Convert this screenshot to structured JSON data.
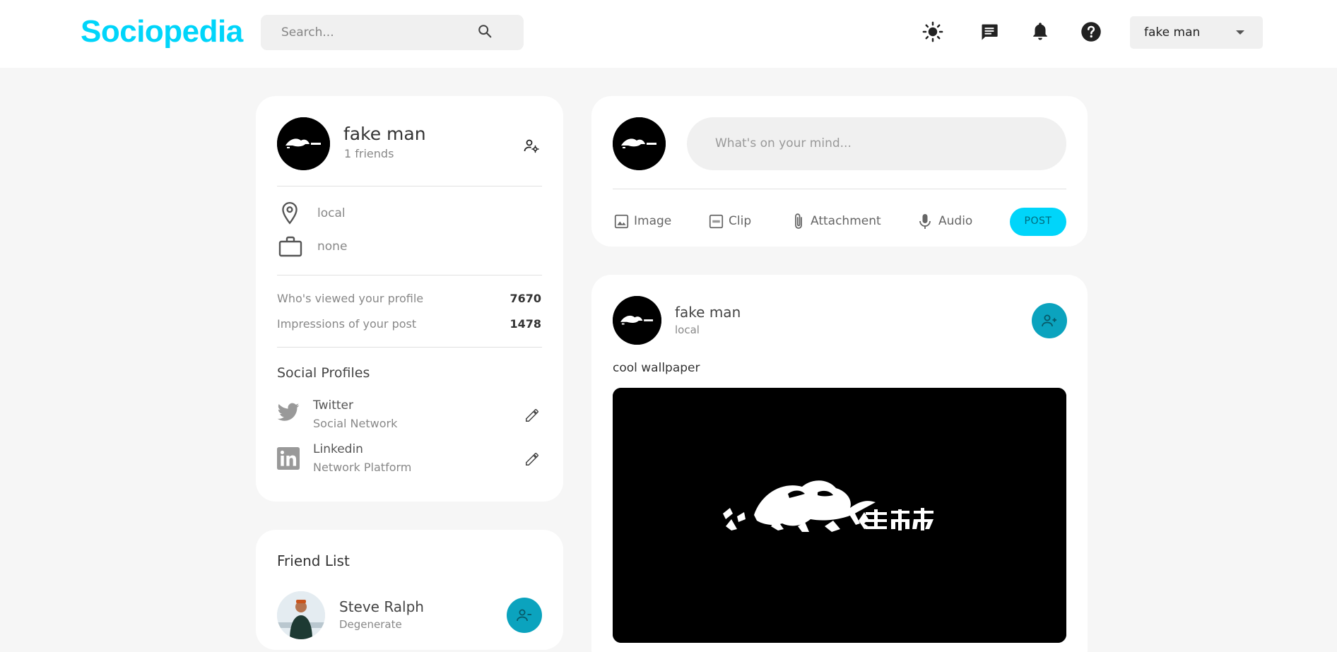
{
  "header": {
    "logo": "Sociopedia",
    "search_placeholder": "Search...",
    "user_name": "fake man"
  },
  "profile": {
    "name": "fake man",
    "friends": "1 friends",
    "location": "local",
    "occupation": "none",
    "stats": [
      {
        "label": "Who's viewed your profile",
        "value": "7670"
      },
      {
        "label": "Impressions of your post",
        "value": "1478"
      }
    ],
    "social_title": "Social Profiles",
    "socials": [
      {
        "name": "Twitter",
        "desc": "Social Network"
      },
      {
        "name": "Linkedin",
        "desc": "Network Platform"
      }
    ]
  },
  "friends": {
    "title": "Friend List",
    "items": [
      {
        "name": "Steve Ralph",
        "occupation": "Degenerate"
      }
    ]
  },
  "composer": {
    "placeholder": "What's on your mind...",
    "actions": [
      "Image",
      "Clip",
      "Attachment",
      "Audio"
    ],
    "post_label": "POST"
  },
  "post": {
    "author": "fake man",
    "location": "local",
    "caption": "cool wallpaper"
  },
  "colors": {
    "primary": "#00d5fa",
    "accent_button": "#0ba3be",
    "background": "#f6f6f6"
  }
}
